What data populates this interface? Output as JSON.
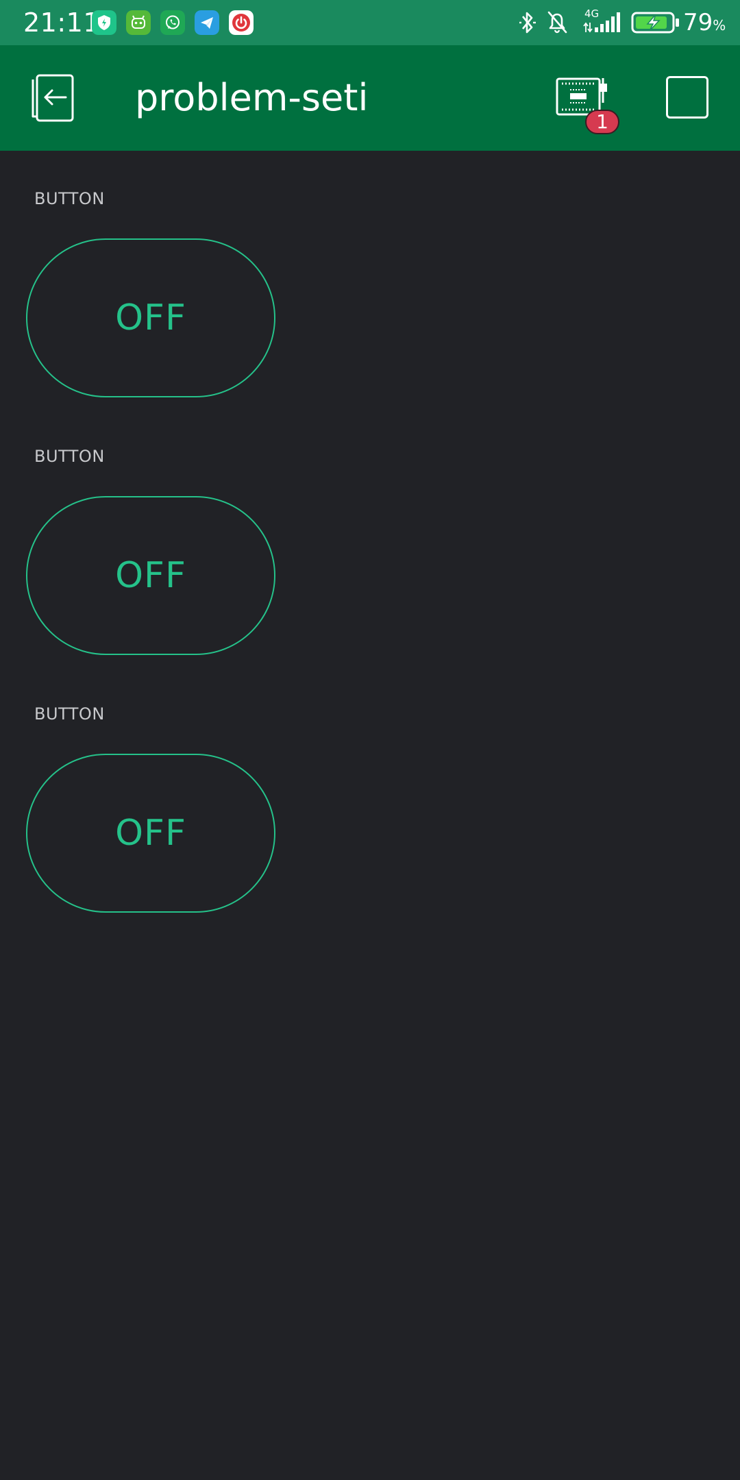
{
  "status_bar": {
    "time": "21:11",
    "network_type": "4G",
    "battery_level": "79",
    "battery_unit": "%",
    "notification_icons": [
      {
        "name": "vpn-shield-icon",
        "color": "#1fc48a"
      },
      {
        "name": "robot-app-icon",
        "color": "#55b939"
      },
      {
        "name": "whatsapp-icon",
        "color": "#1fa855"
      },
      {
        "name": "telegram-icon",
        "color": "#2a9ee1"
      },
      {
        "name": "power-app-icon",
        "color": "#ffffff"
      }
    ]
  },
  "app_bar": {
    "title": "problem-seti",
    "device_badge_count": "1"
  },
  "widgets": [
    {
      "label": "BUTTON",
      "state": "OFF"
    },
    {
      "label": "BUTTON",
      "state": "OFF"
    },
    {
      "label": "BUTTON",
      "state": "OFF"
    }
  ],
  "colors": {
    "status_bar": "#1a8a5e",
    "app_bar": "#00703f",
    "background": "#212226",
    "accent": "#25c28a",
    "badge": "#d63a50"
  }
}
